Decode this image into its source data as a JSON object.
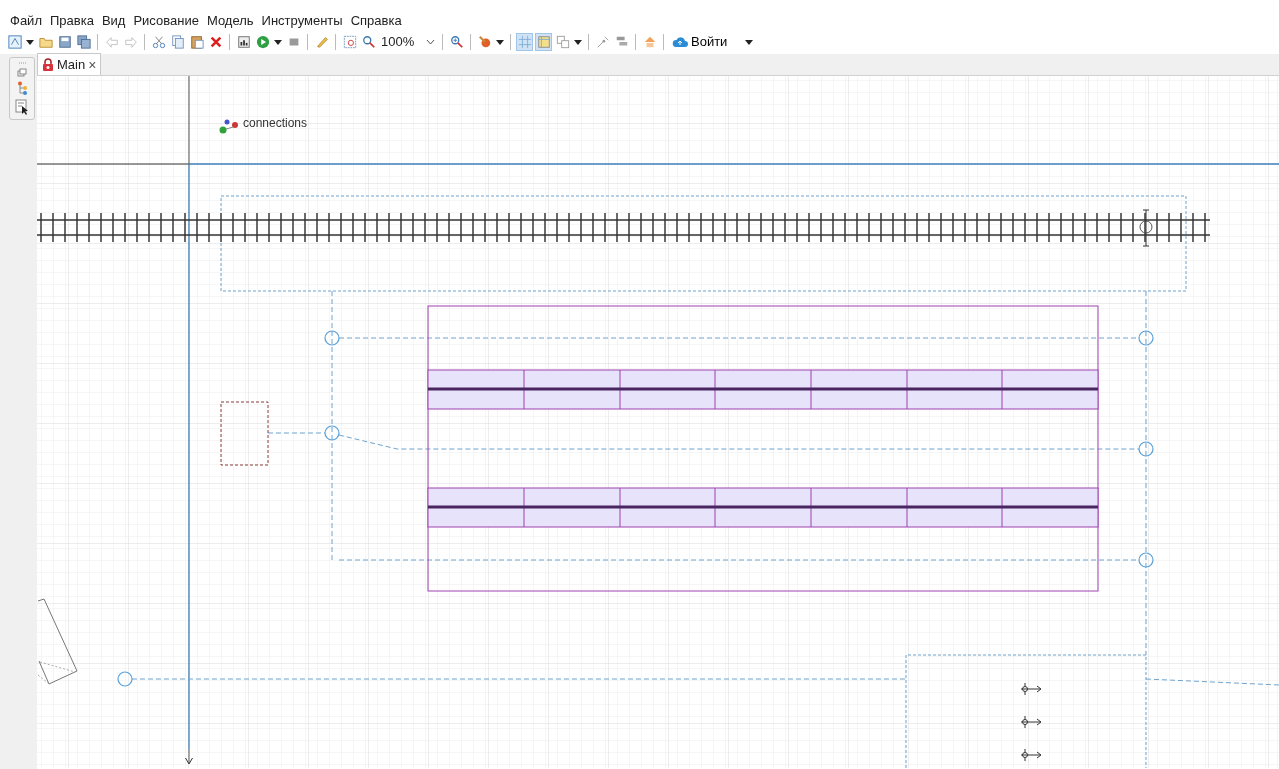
{
  "menu": [
    {
      "label": "Файл"
    },
    {
      "label": "Правка"
    },
    {
      "label": "Вид"
    },
    {
      "label": "Рисование"
    },
    {
      "label": "Модель"
    },
    {
      "label": "Инструменты"
    },
    {
      "label": "Справка"
    }
  ],
  "toolbar": {
    "zoom": "100%",
    "toggles": [
      {
        "selected": true
      },
      {
        "selected": true
      },
      {
        "selected": false
      }
    ],
    "sign_in": "Войти"
  },
  "tabs": [
    {
      "label": "Main",
      "selected": true,
      "close": "×"
    }
  ],
  "canvas": {
    "agent_label": "connections"
  }
}
